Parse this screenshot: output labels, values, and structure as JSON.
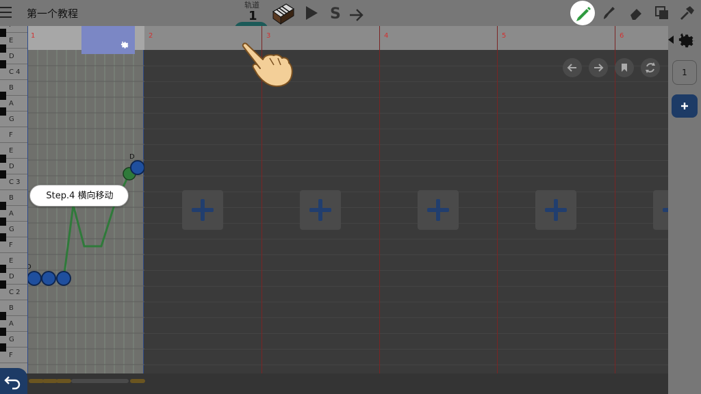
{
  "header": {
    "title": "第一个教程",
    "track_label": "轨道",
    "track_number": "1",
    "solo_label": "S"
  },
  "piano_keys": [
    "F",
    "E",
    "D",
    "C 4",
    "B",
    "A",
    "G",
    "F",
    "E",
    "D",
    "C 3",
    "B",
    "A",
    "G",
    "F",
    "E",
    "D",
    "C 2",
    "B",
    "A",
    "G",
    "F"
  ],
  "ruler": {
    "bars": [
      "1",
      "2",
      "3",
      "4",
      "5",
      "6"
    ]
  },
  "notes": {
    "label_upper": "D",
    "label_lower": "D"
  },
  "tutorial": {
    "step_text": "Step.4 横向移动"
  },
  "right_panel": {
    "track_count": "1"
  },
  "colors": {
    "accent_blue": "#1d3b66",
    "note_blue": "#1f4f9e",
    "note_green": "#2f7a3a",
    "bar_line_red": "#d23030",
    "pencil_green": "#2e9b3f"
  },
  "icons": {
    "menu": "hamburger-icon",
    "piano": "piano-icon",
    "play": "play-icon",
    "next": "arrow-right-icon",
    "pencil": "pencil-icon",
    "brush": "brush-icon",
    "eraser": "eraser-icon",
    "copy": "copy-icon",
    "hammer": "hammer-icon",
    "gear": "gear-icon",
    "back": "undo-icon"
  }
}
